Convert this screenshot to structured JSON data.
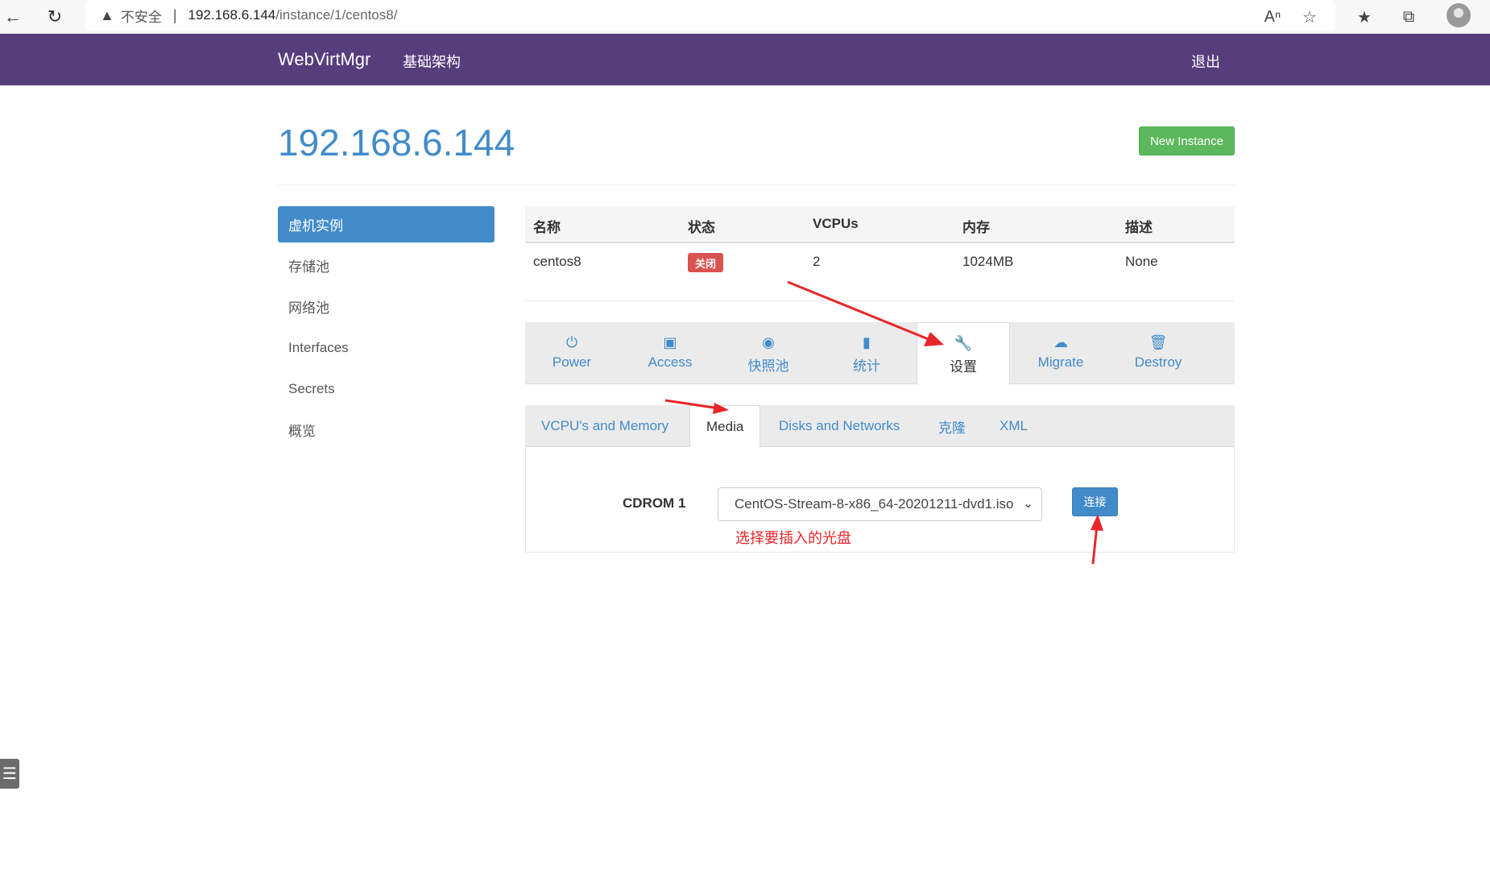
{
  "browser": {
    "insecure_label": "不安全",
    "url_host": "192.168.6.144",
    "url_path": "/instance/1/centos8/"
  },
  "navbar": {
    "brand": "WebVirtMgr",
    "infra_link": "基础架构",
    "logout_link": "退出"
  },
  "page": {
    "title": "192.168.6.144",
    "new_instance_button": "New Instance"
  },
  "sidebar": {
    "items": [
      {
        "label": "虚机实例",
        "active": true
      },
      {
        "label": "存储池"
      },
      {
        "label": "网络池"
      },
      {
        "label": "Interfaces"
      },
      {
        "label": "Secrets"
      },
      {
        "label": "概览"
      }
    ]
  },
  "instance_table": {
    "headers": [
      "名称",
      "状态",
      "VCPUs",
      "内存",
      "描述"
    ],
    "row": {
      "name": "centos8",
      "status": "关闭",
      "vcpus": "2",
      "memory": "1024MB",
      "description": "None"
    },
    "status_color": "#d9534f"
  },
  "action_tabs": [
    {
      "label": "Power",
      "icon": "power-icon"
    },
    {
      "label": "Access",
      "icon": "briefcase-icon"
    },
    {
      "label": "快照池",
      "icon": "camera-icon"
    },
    {
      "label": "统计",
      "icon": "stats-icon"
    },
    {
      "label": "设置",
      "icon": "wrench-icon",
      "active": true
    },
    {
      "label": "Migrate",
      "icon": "cloud-upload-icon"
    },
    {
      "label": "Destroy",
      "icon": "trash-icon"
    }
  ],
  "settings_tabs": [
    {
      "label": "VCPU's and Memory"
    },
    {
      "label": "Media",
      "active": true
    },
    {
      "label": "Disks and Networks"
    },
    {
      "label": "克隆"
    },
    {
      "label": "XML"
    }
  ],
  "media": {
    "cdrom_label": "CDROM 1",
    "cdrom_selected": "CentOS-Stream-8-x86_64-20201211-dvd1.iso",
    "connect_button": "连接",
    "annotation_note": "选择要插入的光盘"
  },
  "colors": {
    "navbar": "#563d7c",
    "primary": "#428bca",
    "success": "#5cb85c",
    "annotation": "#e8262a"
  }
}
